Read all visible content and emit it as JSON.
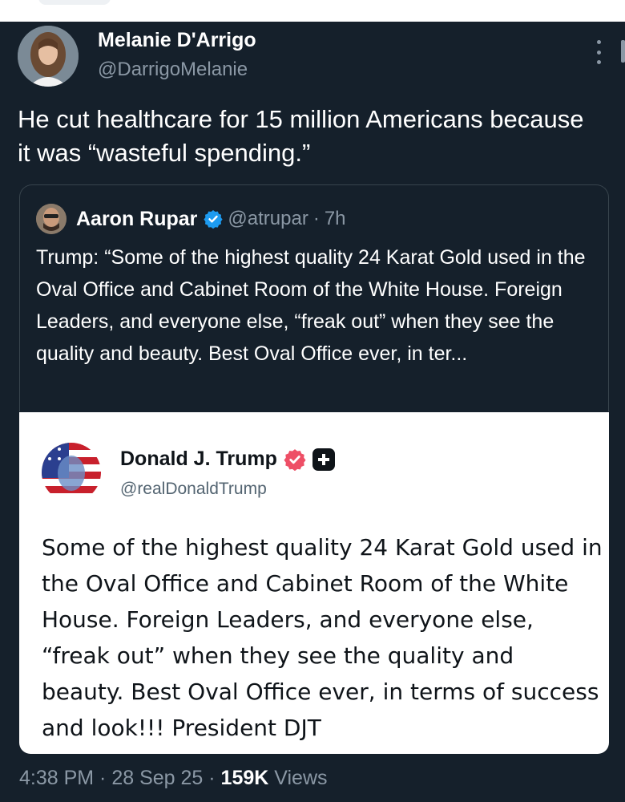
{
  "tweet": {
    "author_name": "Melanie D'Arrigo",
    "author_handle": "@DarrigoMelanie",
    "text": "He cut healthcare for 15 million Americans because it was “wasteful spending.”"
  },
  "quote": {
    "author_name": "Aaron Rupar",
    "author_handle": "@atrupar",
    "separator": "·",
    "time": "7h",
    "text": "Trump: “Some of the highest quality 24 Karat Gold used in the Oval Office and Cabinet Room of the White House. Foreign Leaders, and everyone else, “freak out” when they see the quality and beauty. Best Oval Office ever, in ter..."
  },
  "embedded_post": {
    "author_name": "Donald J. Trump",
    "author_handle": "@realDonaldTrump",
    "text": "Some of the highest quality 24 Karat Gold used in the Oval Office and Cabinet Room of the White House. Foreign Leaders, and everyone else, “freak out” when they see the quality and beauty. Best Oval Office ever, in terms of success and look!!! President DJT"
  },
  "meta": {
    "time": "4:38 PM",
    "sep1": " · ",
    "date": "28 Sep 25",
    "sep2": " · ",
    "views_count": "159K",
    "views_label": " Views"
  },
  "icons": {
    "more": "more-vertical-icon",
    "verified": "verified-badge-icon",
    "embedded_verified": "verified-badge-icon",
    "plus": "plus-icon"
  },
  "colors": {
    "background": "#15202b",
    "verified_blue": "#1d9bf0",
    "embedded_verified": "#ee4f66",
    "muted_text": "#8b98a5"
  }
}
